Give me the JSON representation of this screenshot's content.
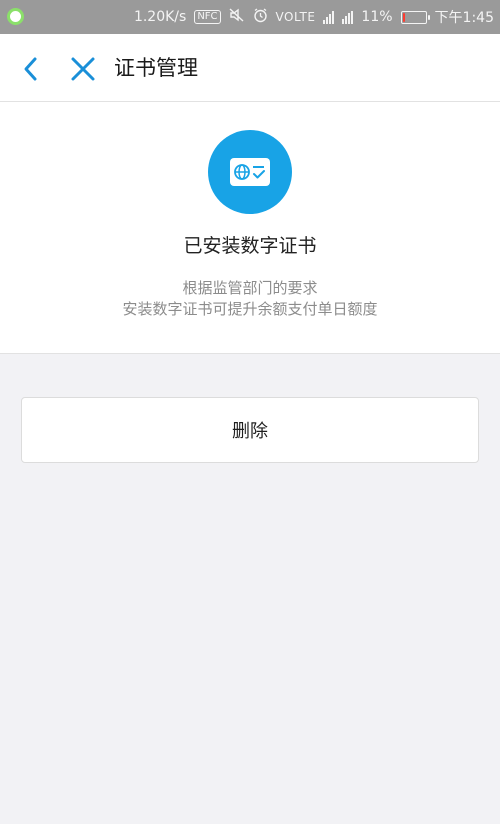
{
  "status_bar": {
    "network_speed": "1.20K/s",
    "nfc": "NFC",
    "volte": "VOLTE",
    "battery_percent": "11%",
    "battery_level": 0.11,
    "time": "下午1:45",
    "icons": [
      "app-notification-icon",
      "mute-icon",
      "alarm-icon",
      "signal-icon",
      "4g-signal-icon",
      "battery-icon"
    ]
  },
  "nav": {
    "title": "证书管理",
    "back_icon": "back-icon",
    "close_icon": "close-icon",
    "accent_color": "#1a8fd8"
  },
  "certificate": {
    "icon": "certificate-icon",
    "icon_color": "#18a3e6",
    "status_title": "已安装数字证书",
    "description_line1": "根据监管部门的要求",
    "description_line2": "安装数字证书可提升余额支付单日额度"
  },
  "actions": {
    "delete_label": "删除"
  }
}
